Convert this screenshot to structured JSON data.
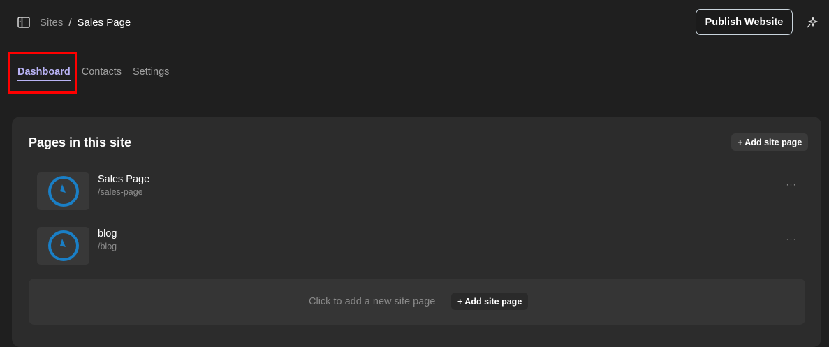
{
  "header": {
    "breadcrumb": {
      "parent": "Sites",
      "separator": "/",
      "current": "Sales Page"
    },
    "publish_label": "Publish Website",
    "icons": {
      "sidebar_toggle": "sidebar-panel-icon",
      "sparkle": "sparkle-icon"
    }
  },
  "tabs": [
    {
      "label": "Dashboard",
      "active": true
    },
    {
      "label": "Contacts",
      "active": false
    },
    {
      "label": "Settings",
      "active": false
    }
  ],
  "panel": {
    "title": "Pages in this site",
    "add_button_label": "+ Add site page",
    "pages": [
      {
        "name": "Sales Page",
        "path": "/sales-page",
        "thumbnail_icon": "clock-icon",
        "more_label": "···"
      },
      {
        "name": "blog",
        "path": "/blog",
        "thumbnail_icon": "clock-icon",
        "more_label": "···"
      }
    ],
    "add_zone": {
      "text": "Click to add a new site page",
      "button_label": "+ Add site page"
    }
  },
  "colors": {
    "background": "#1f1f1f",
    "panel": "#2c2c2c",
    "accent_tab": "#b9b3f5",
    "highlight": "#ff0000",
    "clock_blue": "#1a7fc6"
  }
}
